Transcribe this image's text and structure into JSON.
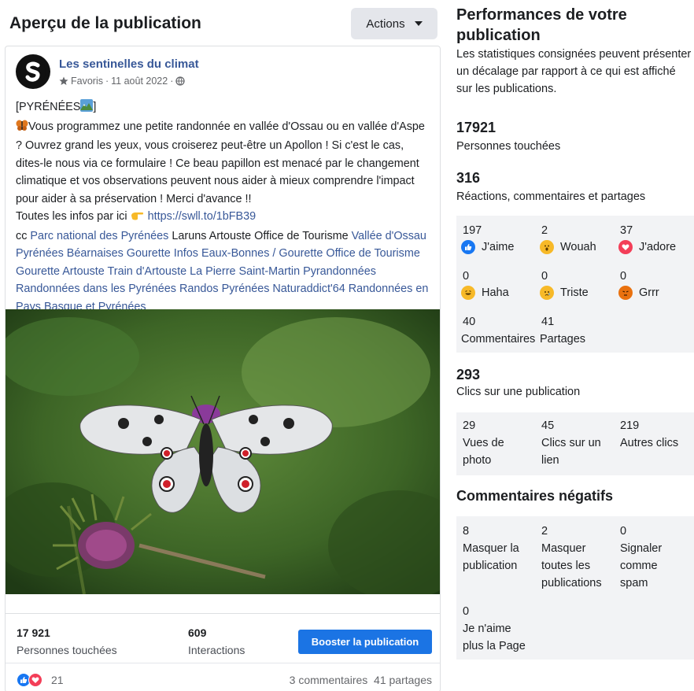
{
  "left": {
    "title": "Aperçu de la publication",
    "actions_label": "Actions"
  },
  "post": {
    "page_name": "Les sentinelles du climat",
    "favorites_label": "Favoris",
    "separator1": " · ",
    "date": "11 août 2022",
    "separator2": " · ",
    "line1": "[PYRÉNÉES",
    "line1_end": "]",
    "body_main": "Vous programmez une petite randonnée en vallée d'Ossau ou en vallée d'Aspe ? Ouvrez grand les yeux, vous croiserez peut-être un Apollon ! Si c'est le cas, dites-le nous via ce formulaire ! Ce beau papillon est menacé par le changement climatique et vos observations peuvent nous aider à mieux comprendre l'impact pour aider à sa préservation ! Merci d'avance !!",
    "infos_prefix": "Toutes les infos par ici ",
    "infos_link": "https://swll.to/1bFB39",
    "cc_prefix": "cc ",
    "tag1": "Parc national des Pyrénées",
    "plain1": " Laruns Artouste Office de Tourisme ",
    "tag2": "Vallée d'Ossau Pyrénées Béarnaises",
    "tag3": " Gourette Infos Eaux-Bonnes / Gourette Office de Tourisme",
    "tag4": " Gourette Artouste Train d'Artouste",
    "tag5": " La Pierre Saint-Martin",
    "tag6": " Pyrandonnées Randonnées dans les Pyrénées Randos Pyrénées Naturaddict'64 Randonnées en Pays Basque et Pyrénées"
  },
  "footer": {
    "reach_num": "17 921",
    "reach_label": "Personnes touchées",
    "interactions_num": "609",
    "interactions_label": "Interactions",
    "boost_label": "Booster la publication",
    "reactions_count": "21",
    "comments_shares": "3 commentaires  41 partages"
  },
  "right": {
    "title": "Performances de votre publication",
    "description": "Les statistiques consignées peuvent présenter un décalage par rapport à ce qui est affiché sur les publications.",
    "reach_num": "17921",
    "reach_label": "Personnes touchées",
    "engagement_num": "316",
    "engagement_label": "Réactions, commentaires et partages",
    "reactions": [
      {
        "count": "197",
        "label": "J'aime",
        "icon": "like-icon",
        "color": "#1877f2"
      },
      {
        "count": "2",
        "label": "Wouah",
        "icon": "wow-icon",
        "color": "#f7b928"
      },
      {
        "count": "37",
        "label": "J'adore",
        "icon": "love-icon",
        "color": "#f33e58"
      },
      {
        "count": "0",
        "label": "Haha",
        "icon": "haha-icon",
        "color": "#f7b928"
      },
      {
        "count": "0",
        "label": "Triste",
        "icon": "sad-icon",
        "color": "#f7b928"
      },
      {
        "count": "0",
        "label": "Grrr",
        "icon": "angry-icon",
        "color": "#e9710f"
      }
    ],
    "comments_num": "40",
    "comments_label": "Commentaires",
    "shares_num": "41",
    "shares_label": "Partages",
    "clicks_num": "293",
    "clicks_label": "Clics sur une publication",
    "clicks": [
      {
        "count": "29",
        "label_l1": "Vues de",
        "label_l2": "photo"
      },
      {
        "count": "45",
        "label_l1": "Clics sur un",
        "label_l2": "lien"
      },
      {
        "count": "219",
        "label_l1": "Autres clics",
        "label_l2": ""
      }
    ],
    "negative_title": "Commentaires négatifs",
    "negative": [
      {
        "count": "8",
        "l1": "Masquer la",
        "l2": "publication",
        "l3": ""
      },
      {
        "count": "2",
        "l1": "Masquer",
        "l2": "toutes les",
        "l3": "publications"
      },
      {
        "count": "0",
        "l1": "Signaler",
        "l2": "comme",
        "l3": "spam"
      },
      {
        "count": "0",
        "l1": "Je n'aime",
        "l2": "plus la Page",
        "l3": ""
      }
    ]
  }
}
